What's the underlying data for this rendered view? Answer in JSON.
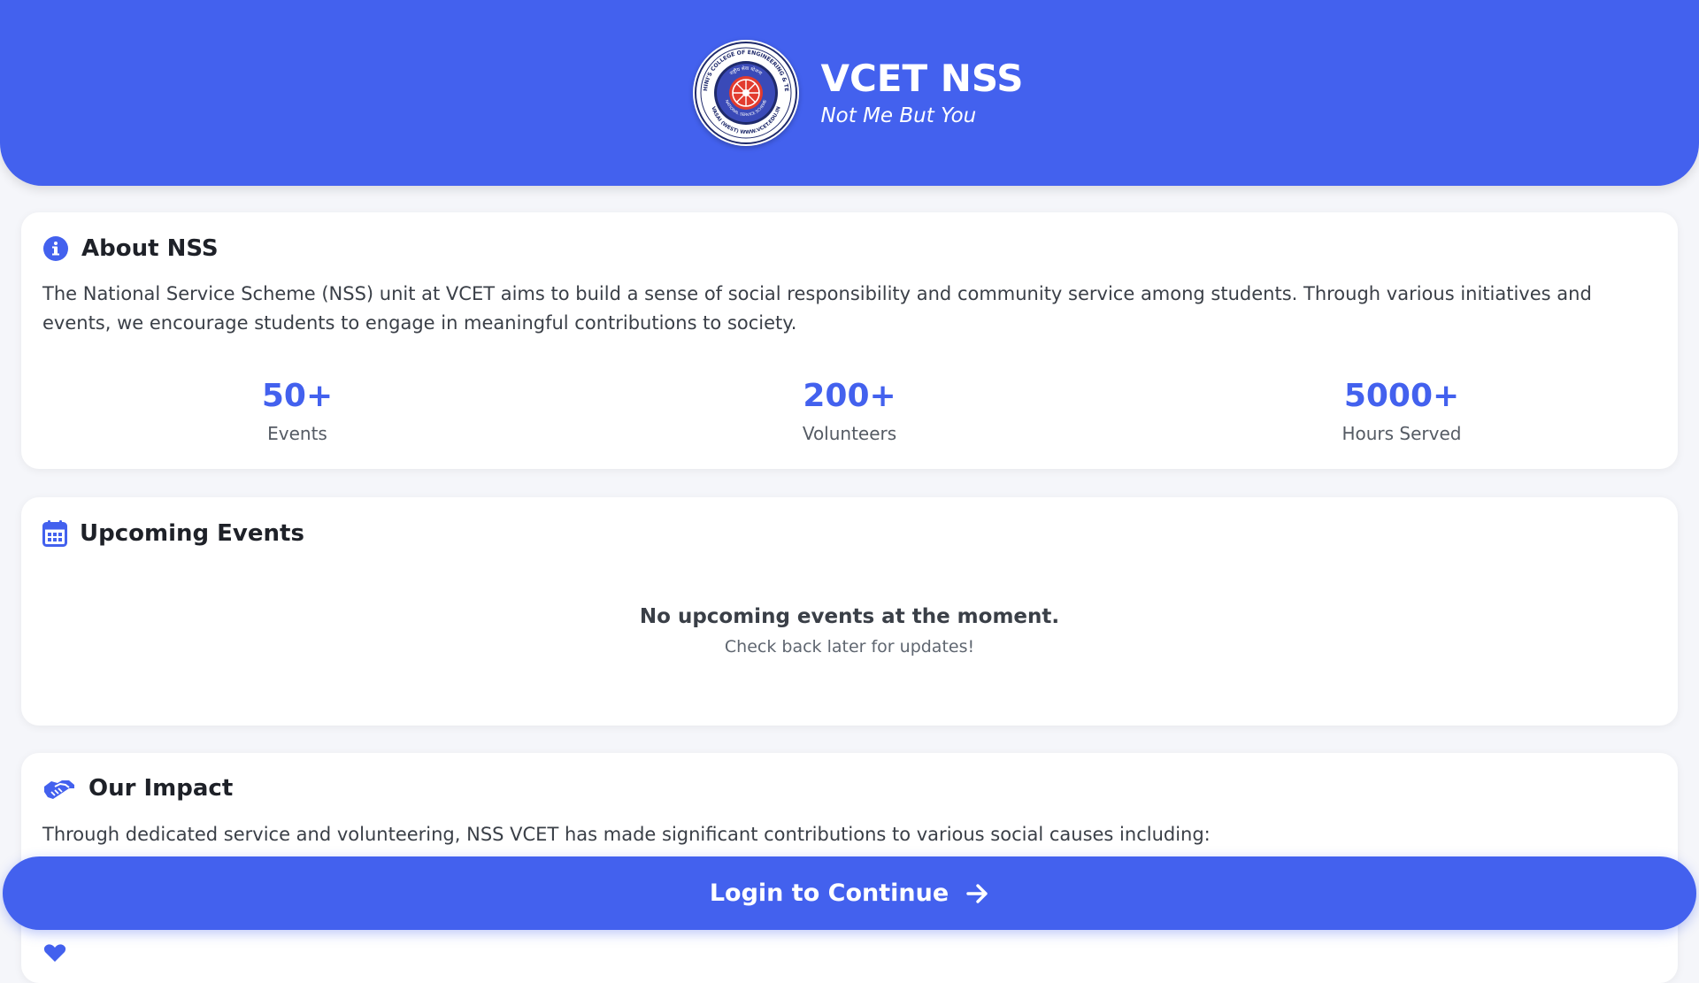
{
  "header": {
    "title": "VCET NSS",
    "tagline": "Not Me But You",
    "logo_ring_text": "VIDYAVARDHINI'S COLLEGE OF ENGINEERING & TECHNOLOGY",
    "logo_inner_text": "राष्ट्रीय सेवा योजना",
    "logo_bottom_text": "NATIONAL SERVICE SCHEME",
    "logo_footer_text": "VASAI (WEST) WWW.VCET.EDU.IN"
  },
  "about": {
    "icon": "info-icon",
    "title": "About NSS",
    "description": "The National Service Scheme (NSS) unit at VCET aims to build a sense of social responsibility and community service among students. Through various initiatives and events, we encourage students to engage in meaningful contributions to society.",
    "stats": [
      {
        "value": "50+",
        "label": "Events"
      },
      {
        "value": "200+",
        "label": "Volunteers"
      },
      {
        "value": "5000+",
        "label": "Hours Served"
      }
    ]
  },
  "events": {
    "icon": "calendar-icon",
    "title": "Upcoming Events",
    "empty_title": "No upcoming events at the moment.",
    "empty_subtitle": "Check back later for updates!"
  },
  "impact": {
    "icon": "handshake-icon",
    "title": "Our Impact",
    "description": "Through dedicated service and volunteering, NSS VCET has made significant contributions to various social causes including:"
  },
  "login": {
    "label": "Login to Continue",
    "icon": "arrow-right-icon"
  },
  "colors": {
    "primary": "#4361ee",
    "background": "#f5f6fa",
    "logo_red": "#e23b2e",
    "logo_navy": "#1f2a6b"
  }
}
